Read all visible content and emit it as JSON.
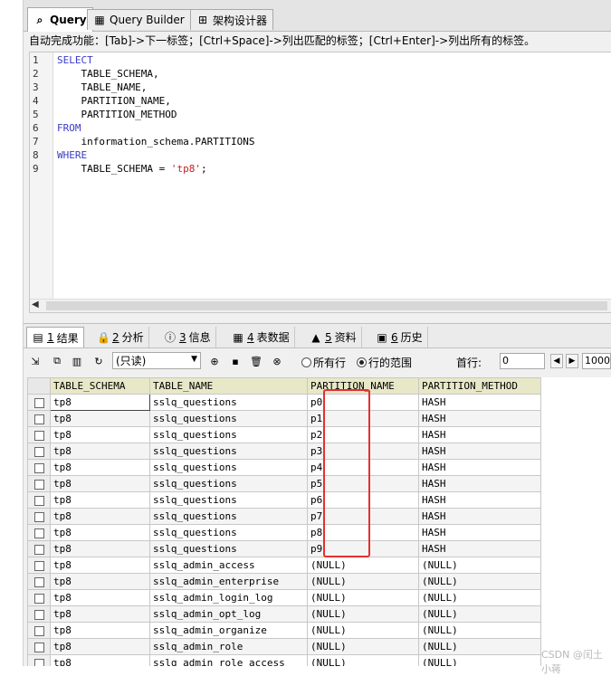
{
  "tabs": [
    {
      "label": "Query",
      "icon": "query-icon"
    },
    {
      "label": "Query Builder",
      "icon": "query-builder-icon"
    },
    {
      "label": "架构设计器",
      "icon": "schema-designer-icon"
    }
  ],
  "hint": "自动完成功能：[Tab]->下一标签；[Ctrl+Space]->列出匹配的标签；[Ctrl+Enter]->列出所有的标签。",
  "editor": {
    "line_numbers": [
      "1",
      "2",
      "3",
      "4",
      "5",
      "6",
      "7",
      "8",
      "9"
    ],
    "lines": [
      {
        "kw": "SELECT",
        "text": "",
        "str": "",
        "end": ""
      },
      {
        "kw": "",
        "text": "    TABLE_SCHEMA,",
        "str": "",
        "end": ""
      },
      {
        "kw": "",
        "text": "    TABLE_NAME,",
        "str": "",
        "end": ""
      },
      {
        "kw": "",
        "text": "    PARTITION_NAME,",
        "str": "",
        "end": ""
      },
      {
        "kw": "",
        "text": "    PARTITION_METHOD",
        "str": "",
        "end": ""
      },
      {
        "kw": "FROM",
        "text": "",
        "str": "",
        "end": ""
      },
      {
        "kw": "",
        "text": "    information_schema.PARTITIONS",
        "str": "",
        "end": ""
      },
      {
        "kw": "WHERE",
        "text": "",
        "str": "",
        "end": ""
      },
      {
        "kw": "",
        "text": "    TABLE_SCHEMA = ",
        "str": "'tp8'",
        "end": ";"
      }
    ]
  },
  "result_tabs": [
    {
      "num": "1",
      "label": "结果"
    },
    {
      "num": "2",
      "label": "分析"
    },
    {
      "num": "3",
      "label": "信息"
    },
    {
      "num": "4",
      "label": "表数据"
    },
    {
      "num": "5",
      "label": "资料"
    },
    {
      "num": "6",
      "label": "历史"
    }
  ],
  "toolbar": {
    "mode": "(只读)",
    "radio_all": "所有行",
    "radio_range": "行的范围",
    "first_row_label": "首行:",
    "first_row_value": "0",
    "row_count_value": "1000"
  },
  "grid": {
    "columns": [
      "TABLE_SCHEMA",
      "TABLE_NAME",
      "PARTITION_NAME",
      "PARTITION_METHOD"
    ],
    "rows": [
      [
        "tp8",
        "sslq_questions",
        "p0",
        "HASH"
      ],
      [
        "tp8",
        "sslq_questions",
        "p1",
        "HASH"
      ],
      [
        "tp8",
        "sslq_questions",
        "p2",
        "HASH"
      ],
      [
        "tp8",
        "sslq_questions",
        "p3",
        "HASH"
      ],
      [
        "tp8",
        "sslq_questions",
        "p4",
        "HASH"
      ],
      [
        "tp8",
        "sslq_questions",
        "p5",
        "HASH"
      ],
      [
        "tp8",
        "sslq_questions",
        "p6",
        "HASH"
      ],
      [
        "tp8",
        "sslq_questions",
        "p7",
        "HASH"
      ],
      [
        "tp8",
        "sslq_questions",
        "p8",
        "HASH"
      ],
      [
        "tp8",
        "sslq_questions",
        "p9",
        "HASH"
      ],
      [
        "tp8",
        "sslq_admin_access",
        "(NULL)",
        "(NULL)"
      ],
      [
        "tp8",
        "sslq_admin_enterprise",
        "(NULL)",
        "(NULL)"
      ],
      [
        "tp8",
        "sslq_admin_login_log",
        "(NULL)",
        "(NULL)"
      ],
      [
        "tp8",
        "sslq_admin_opt_log",
        "(NULL)",
        "(NULL)"
      ],
      [
        "tp8",
        "sslq_admin_organize",
        "(NULL)",
        "(NULL)"
      ],
      [
        "tp8",
        "sslq_admin_role",
        "(NULL)",
        "(NULL)"
      ],
      [
        "tp8",
        "sslq_admin_role_access",
        "(NULL)",
        "(NULL)"
      ]
    ]
  },
  "watermark": "CSDN @闰土小蒋"
}
